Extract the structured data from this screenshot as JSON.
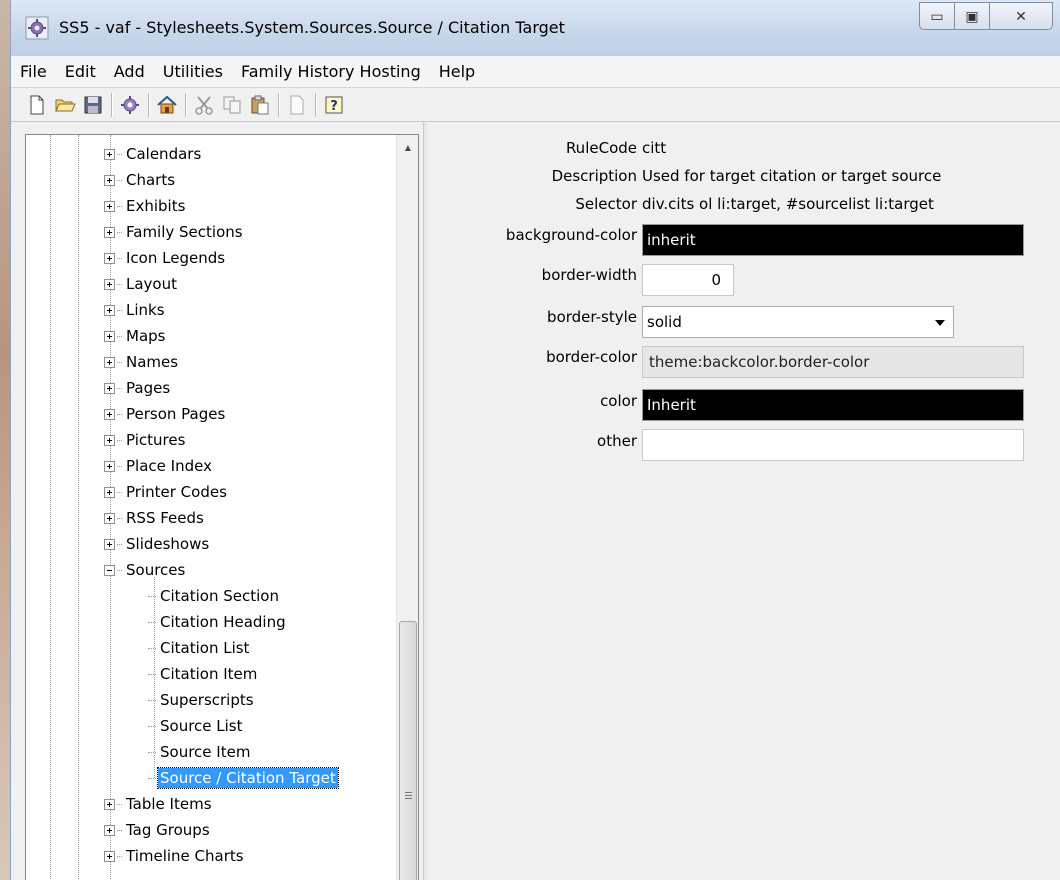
{
  "window": {
    "title": "SS5 - vaf - Stylesheets.System.Sources.Source / Citation Target",
    "minimize_glyph": "▭",
    "maximize_glyph": "▣",
    "close_glyph": "✕"
  },
  "menu": [
    "File",
    "Edit",
    "Add",
    "Utilities",
    "Family History Hosting",
    "Help"
  ],
  "toolbar": {
    "icons": [
      "new-file-icon",
      "open-folder-icon",
      "save-icon",
      "settings-gear-icon",
      "home-icon",
      "cut-icon",
      "copy-icon",
      "paste-icon",
      "blank-page-icon",
      "help-icon"
    ]
  },
  "tree": {
    "top_items": [
      "Calendars",
      "Charts",
      "Exhibits",
      "Family Sections",
      "Icon Legends",
      "Layout",
      "Links",
      "Maps",
      "Names",
      "Pages",
      "Person Pages",
      "Pictures",
      "Place Index",
      "Printer Codes",
      "RSS Feeds",
      "Slideshows"
    ],
    "expanded_item": "Sources",
    "children": [
      "Citation Section",
      "Citation Heading",
      "Citation List",
      "Citation Item",
      "Superscripts",
      "Source List",
      "Source Item",
      "Source / Citation Target"
    ],
    "selected_child": "Source / Citation Target",
    "bottom_items": [
      "Table Items",
      "Tag Groups",
      "Timeline Charts"
    ]
  },
  "properties": {
    "rulecode": {
      "label": "RuleCode",
      "value": "citt"
    },
    "description": {
      "label": "Description",
      "value": "Used for target citation or target source"
    },
    "selector": {
      "label": "Selector",
      "value": "div.cits ol li:target, #sourcelist li:target"
    },
    "background_color": {
      "label": "background-color",
      "value": "inherit"
    },
    "border_width": {
      "label": "border-width",
      "value": "0"
    },
    "border_style": {
      "label": "border-style",
      "value": "solid"
    },
    "border_color": {
      "label": "border-color",
      "value": "theme:backcolor.border-color"
    },
    "color": {
      "label": "color",
      "value": "Inherit"
    },
    "other": {
      "label": "other",
      "value": ""
    }
  },
  "colors": {
    "selection": "#3399ff",
    "dark_field": "#000000",
    "titlebar": "#cad9eb"
  }
}
